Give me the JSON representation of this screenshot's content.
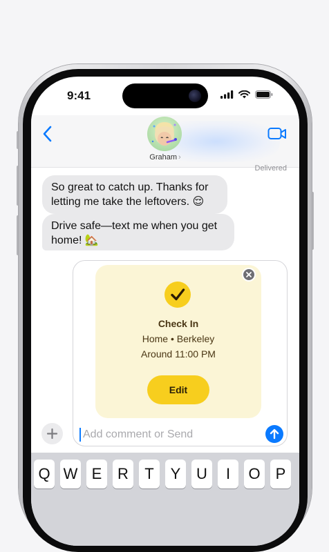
{
  "status_bar": {
    "time": "9:41"
  },
  "header": {
    "contact_name": "Graham",
    "contact_chevron": "›",
    "delivered_label": "Delivered"
  },
  "messages": [
    {
      "line1": "So great to catch up. Thanks for",
      "line2": "letting me take the leftovers. ",
      "emoji": "😌"
    },
    {
      "line1": "Drive safe—text me when you get",
      "line2": "home! ",
      "emoji": "🏡"
    }
  ],
  "check_in": {
    "title": "Check In",
    "destination": "Home • Berkeley",
    "eta": "Around 11:00 PM",
    "edit_label": "Edit"
  },
  "compose": {
    "placeholder": "Add comment or Send"
  },
  "keyboard": {
    "row1": [
      "Q",
      "W",
      "E",
      "R",
      "T",
      "Y",
      "U",
      "I",
      "O",
      "P"
    ]
  },
  "colors": {
    "accent": "#0a7aff",
    "checkin_yellow": "#f7ce1e",
    "checkin_bg": "#fbf5d6",
    "bubble_gray": "#e9e9eb"
  },
  "icons": [
    "chevron-left-icon",
    "video-camera-icon",
    "signal-icon",
    "wifi-icon",
    "battery-icon",
    "close-icon",
    "checkmark-icon",
    "plus-icon",
    "arrow-up-icon"
  ]
}
